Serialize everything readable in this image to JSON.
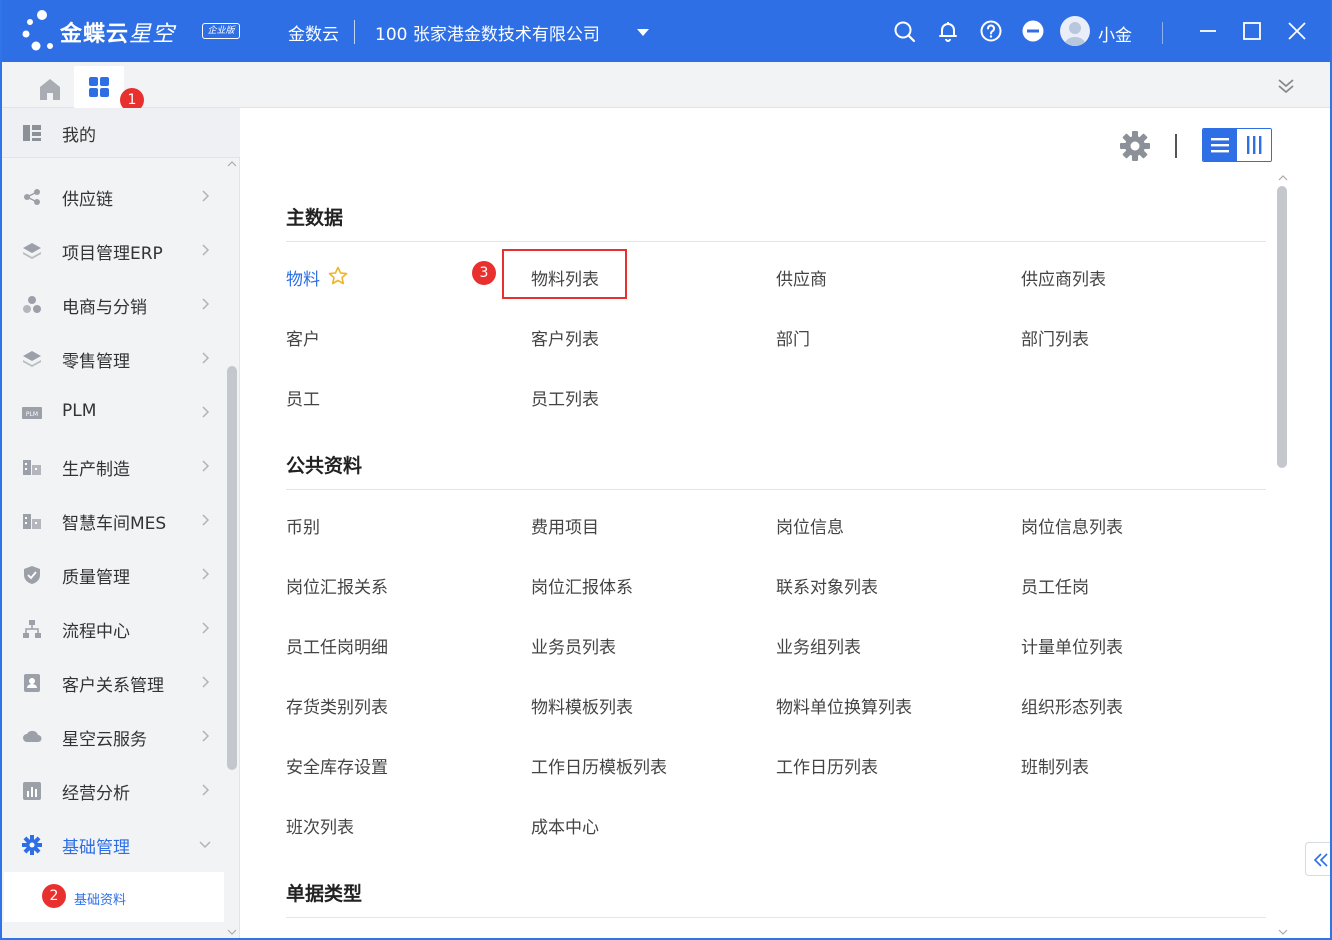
{
  "header": {
    "brand": "金蝶云",
    "brand_suffix": "星空",
    "edition_badge": "企业版",
    "tenant": "金数云",
    "company": "100  张家港金数技术有限公司",
    "user_name": "小金",
    "icons": [
      "search-icon",
      "bell-icon",
      "help-icon",
      "more-icon",
      "avatar",
      "minimize-icon",
      "maximize-icon",
      "close-icon"
    ]
  },
  "tabbar": {
    "badge_1": "1"
  },
  "sidebar": {
    "mine_label": "我的",
    "items": [
      {
        "label": "供应链",
        "icon": "supply-chain-icon"
      },
      {
        "label": "项目管理ERP",
        "icon": "layers-icon"
      },
      {
        "label": "电商与分销",
        "icon": "cluster-icon"
      },
      {
        "label": "零售管理",
        "icon": "layers-icon"
      },
      {
        "label": "PLM",
        "icon": "plm-icon"
      },
      {
        "label": "生产制造",
        "icon": "factory-icon"
      },
      {
        "label": "智慧车间MES",
        "icon": "factory-icon"
      },
      {
        "label": "质量管理",
        "icon": "shield-icon"
      },
      {
        "label": "流程中心",
        "icon": "flow-icon"
      },
      {
        "label": "客户关系管理",
        "icon": "contact-icon"
      },
      {
        "label": "星空云服务",
        "icon": "cloud-icon"
      },
      {
        "label": "经营分析",
        "icon": "chart-icon"
      },
      {
        "label": "基础管理",
        "icon": "gear-icon"
      }
    ],
    "sub_item": "基础资料",
    "badge_2": "2"
  },
  "main": {
    "badge_3": "3",
    "sections": [
      {
        "title": "主数据",
        "rows": [
          [
            "物料",
            "物料列表",
            "供应商",
            "供应商列表"
          ],
          [
            "客户",
            "客户列表",
            "部门",
            "部门列表"
          ],
          [
            "员工",
            "员工列表"
          ]
        ]
      },
      {
        "title": "公共资料",
        "rows": [
          [
            "币别",
            "费用项目",
            "岗位信息",
            "岗位信息列表"
          ],
          [
            "岗位汇报关系",
            "岗位汇报体系",
            "联系对象列表",
            "员工任岗"
          ],
          [
            "员工任岗明细",
            "业务员列表",
            "业务组列表",
            "计量单位列表"
          ],
          [
            "存货类别列表",
            "物料模板列表",
            "物料单位换算列表",
            "组织形态列表"
          ],
          [
            "安全库存设置",
            "工作日历模板列表",
            "工作日历列表",
            "班制列表"
          ],
          [
            "班次列表",
            "成本中心"
          ]
        ]
      },
      {
        "title": "单据类型",
        "rows": []
      }
    ]
  },
  "colors": {
    "brand_blue": "#2e6fe6",
    "badge_red": "#e8312f"
  }
}
